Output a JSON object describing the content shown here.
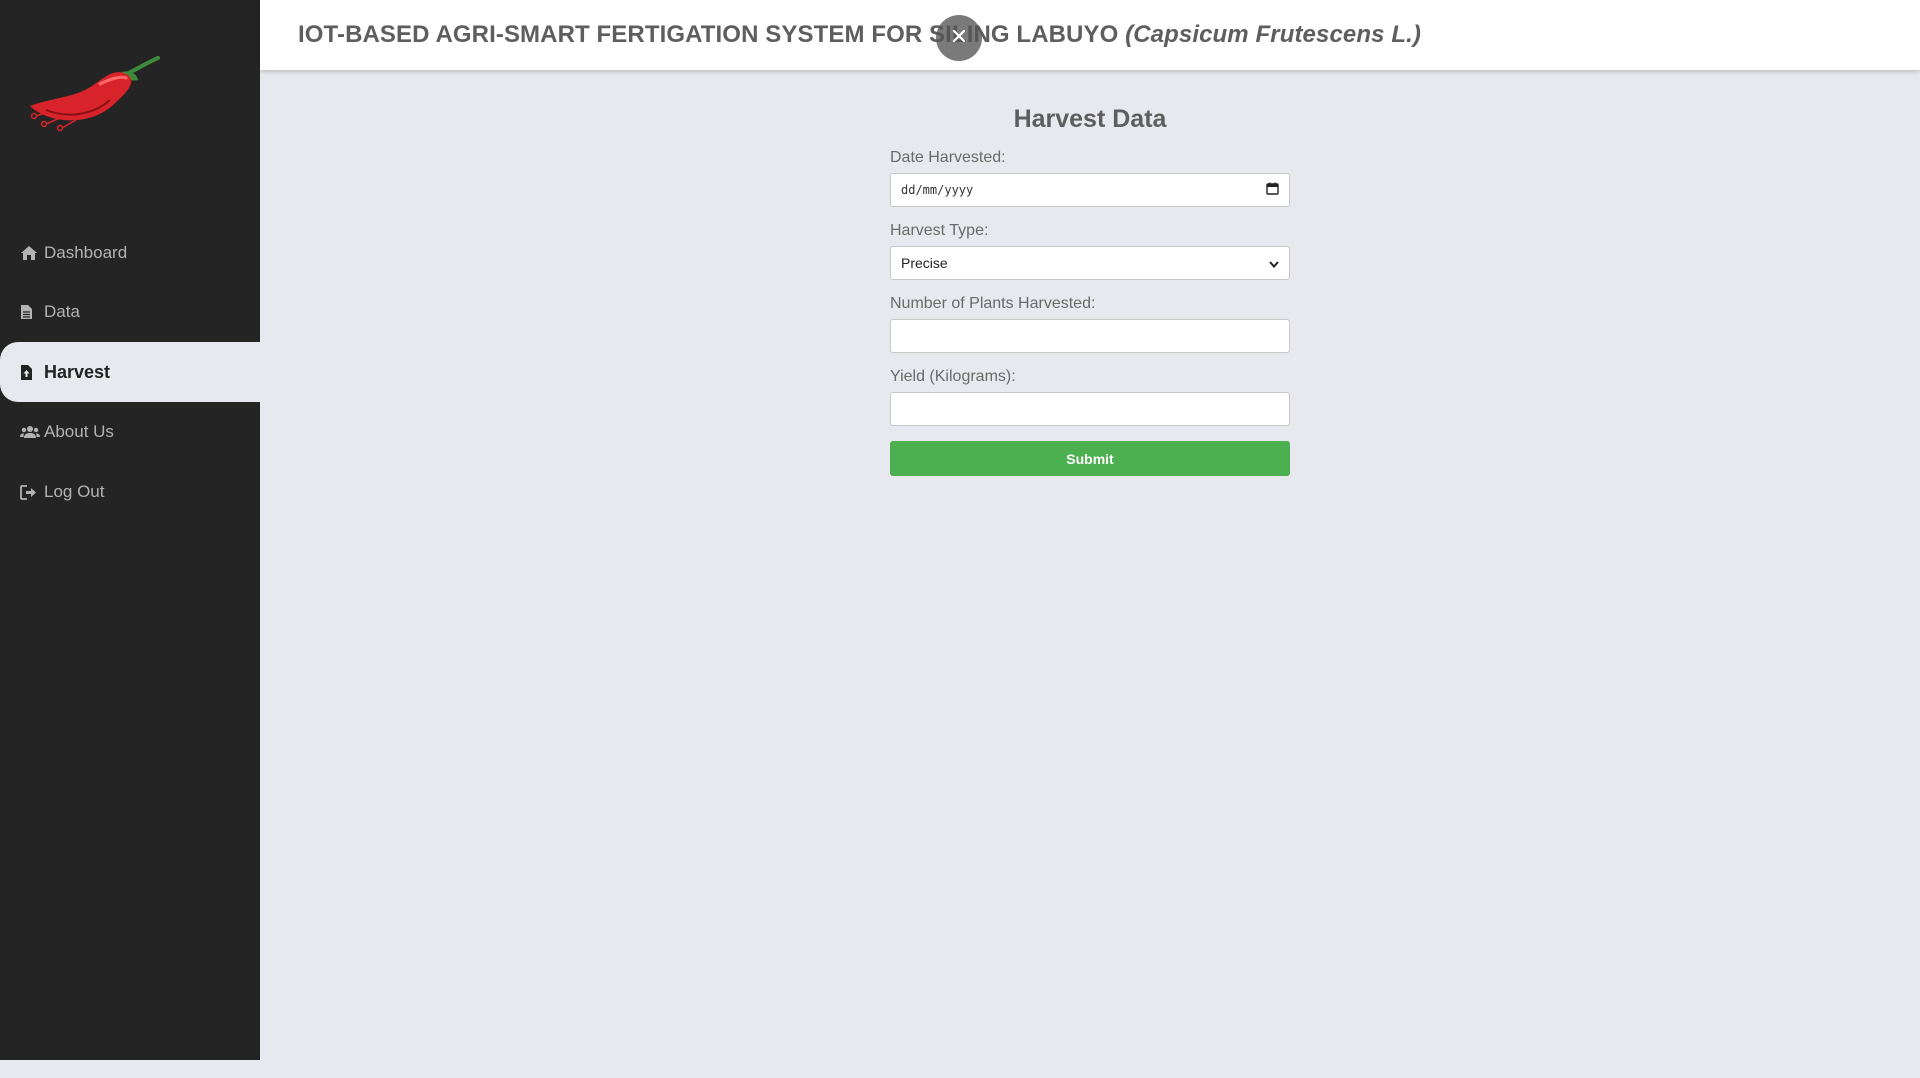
{
  "header": {
    "title_main": "IOT-BASED AGRI-SMART FERTIGATION SYSTEM FOR SILING LABUYO ",
    "title_italic": "(Capsicum Frutescens L.)"
  },
  "sidebar": {
    "items": [
      {
        "label": "Dashboard",
        "icon": "home-icon"
      },
      {
        "label": "Data",
        "icon": "file-icon"
      },
      {
        "label": "Harvest",
        "icon": "file-upload-icon",
        "active": true
      },
      {
        "label": "About Us",
        "icon": "users-icon"
      },
      {
        "label": "Log Out",
        "icon": "sign-out-icon"
      }
    ]
  },
  "form": {
    "title": "Harvest Data",
    "date_label": "Date Harvested:",
    "date_placeholder": "dd/mm/yyyy",
    "type_label": "Harvest Type:",
    "type_value": "Precise",
    "plants_label": "Number of Plants Harvested:",
    "plants_value": "",
    "yield_label": "Yield (Kilograms):",
    "yield_value": "",
    "submit_label": "Submit"
  },
  "colors": {
    "sidebar_bg": "#242424",
    "content_bg": "#e8e9ee",
    "submit_green": "#4caf50"
  }
}
